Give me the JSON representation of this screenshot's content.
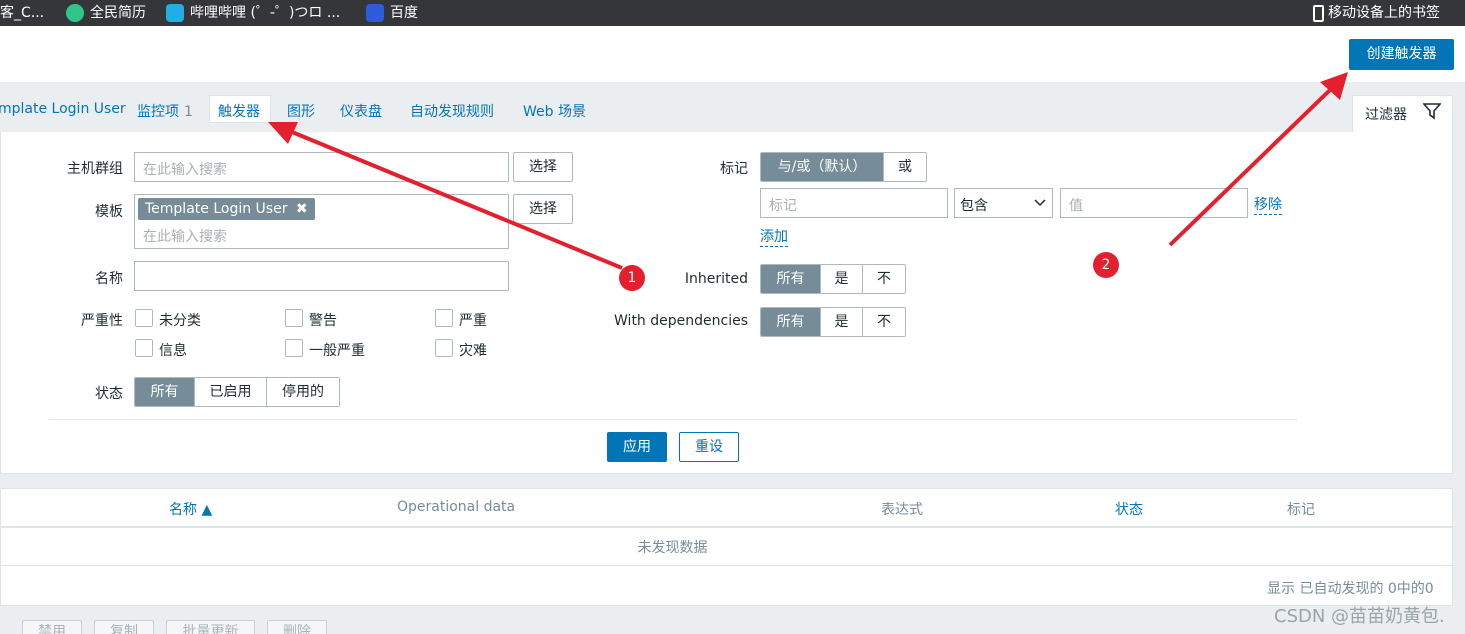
{
  "bookmarks": [
    {
      "label": "客_C...",
      "icon": "tab-icon"
    },
    {
      "label": "全民简历",
      "icon": "resume-app-icon"
    },
    {
      "label": "哔哩哔哩 (゜-゜)つロ ...",
      "icon": "bilibili-icon"
    },
    {
      "label": "百度",
      "icon": "baidu-paw-icon"
    },
    {
      "label": "移动设备上的书签",
      "icon": "mobile-device-icon"
    }
  ],
  "header": {
    "create_trigger": "创建触发器"
  },
  "tabs": [
    {
      "label": "mplate Login User"
    },
    {
      "label": "监控项",
      "count": "1"
    },
    {
      "label": "触发器"
    },
    {
      "label": "图形"
    },
    {
      "label": "仪表盘"
    },
    {
      "label": "自动发现规则"
    },
    {
      "label": "Web 场景"
    }
  ],
  "filter_tab": {
    "label": "过滤器",
    "icon": "filter-funnel-icon"
  },
  "filter": {
    "host_group": {
      "label": "主机群组",
      "placeholder": "在此输入搜索",
      "select": "选择"
    },
    "template": {
      "label": "模板",
      "chip": "Template Login User",
      "placeholder": "在此输入搜索",
      "select": "选择"
    },
    "name": {
      "label": "名称",
      "value": ""
    },
    "severity": {
      "label": "严重性",
      "options": [
        "未分类",
        "警告",
        "严重",
        "信息",
        "一般严重",
        "灾难"
      ]
    },
    "state": {
      "label": "状态",
      "options": [
        "所有",
        "已启用",
        "停用的"
      ],
      "selected": "所有"
    },
    "tags": {
      "label": "标记",
      "operator": [
        "与/或（默认）",
        "或"
      ],
      "tag_placeholder": "标记",
      "condition": "包含",
      "value_placeholder": "值",
      "remove": "移除",
      "add": "添加"
    },
    "inherited": {
      "label": "Inherited",
      "options": [
        "所有",
        "是",
        "不"
      ]
    },
    "with_dependencies": {
      "label": "With dependencies",
      "options": [
        "所有",
        "是",
        "不"
      ]
    },
    "apply": "应用",
    "reset": "重设"
  },
  "table": {
    "columns": [
      "名称 ▲",
      "Operational data",
      "表达式",
      "状态",
      "标记"
    ],
    "empty": "未发现数据",
    "footer": "显示 已自动发现的 0中的0"
  },
  "bulk_actions": [
    "禁用",
    "复制",
    "批量更新",
    "删除"
  ],
  "annotations": {
    "badge1": "1",
    "badge2": "2",
    "arrow_color": "#e5202e"
  },
  "watermark": "CSDN @苗苗奶黄包."
}
